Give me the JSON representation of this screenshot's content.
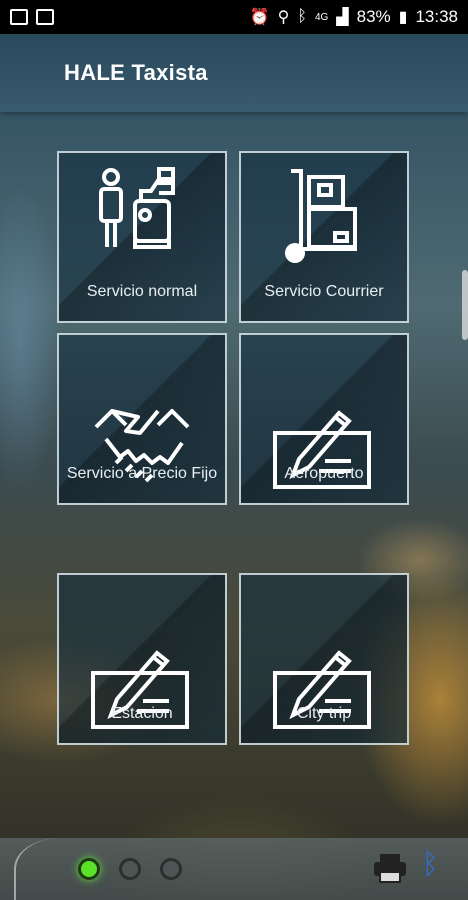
{
  "status_bar": {
    "battery_percent": "83%",
    "time": "13:38",
    "network": "4G"
  },
  "app_bar": {
    "title": "HALE Taxista"
  },
  "tiles": [
    {
      "label": "Servicio normal",
      "icon": "person-scanner-icon"
    },
    {
      "label": "Servicio Courrier",
      "icon": "hand-truck-boxes-icon"
    },
    {
      "label": "Servicio a Precio Fijo",
      "icon": "handshake-icon"
    },
    {
      "label": "Aeropuerto",
      "icon": "sign-document-icon"
    },
    {
      "label": "Estacion",
      "icon": "sign-document-icon"
    },
    {
      "label": "City trip",
      "icon": "sign-document-icon"
    }
  ],
  "bottom_bar": {
    "indicators": [
      "active",
      "inactive",
      "inactive"
    ],
    "colors": {
      "active": "#5ce12a",
      "bluetooth": "#2f6fd6"
    }
  }
}
